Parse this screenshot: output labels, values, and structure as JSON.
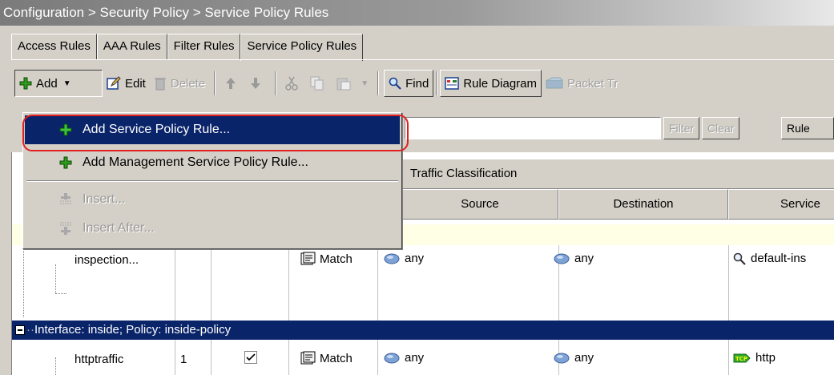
{
  "breadcrumb": "Configuration > Security Policy > Service Policy Rules",
  "tabs": [
    "Access Rules",
    "AAA Rules",
    "Filter Rules",
    "Service Policy Rules"
  ],
  "toolbar": {
    "add": "Add",
    "edit": "Edit",
    "delete": "Delete",
    "find": "Find",
    "rule_diagram": "Rule Diagram",
    "packet_tracer": "Packet Tr"
  },
  "filter": {
    "filter_label": "Filter",
    "clear_label": "Clear",
    "rule_label": "Rule"
  },
  "add_menu": {
    "items": [
      {
        "label": "Add Service Policy Rule...",
        "icon": "green-plus-icon",
        "selected": true,
        "enabled": true
      },
      {
        "label": "Add Management Service Policy Rule...",
        "icon": "green-plus-icon",
        "selected": false,
        "enabled": true
      },
      {
        "label": "Insert...",
        "icon": "insert-icon",
        "selected": false,
        "enabled": false
      },
      {
        "label": "Insert After...",
        "icon": "insert-after-icon",
        "selected": false,
        "enabled": false
      }
    ]
  },
  "table": {
    "group_header": "Traffic Classification",
    "columns": {
      "source": "Source",
      "destination": "Destination",
      "service": "Service"
    },
    "rows": [
      {
        "name": "inspection...",
        "order": "",
        "enabled": null,
        "match": "Match",
        "source": "any",
        "destination": "any",
        "service": "default-ins",
        "service_icon": "search-icon"
      }
    ],
    "interface_group": "Interface: inside; Policy: inside-policy",
    "interface_rows": [
      {
        "name": "httptraffic",
        "order": "1",
        "enabled": true,
        "match": "Match",
        "source": "any",
        "destination": "any",
        "service": "http",
        "service_icon": "tcp-icon"
      }
    ]
  },
  "colors": {
    "selection": "#0a246a",
    "highlight_oval": "#e02020",
    "window_bg": "#d4d0c8"
  }
}
